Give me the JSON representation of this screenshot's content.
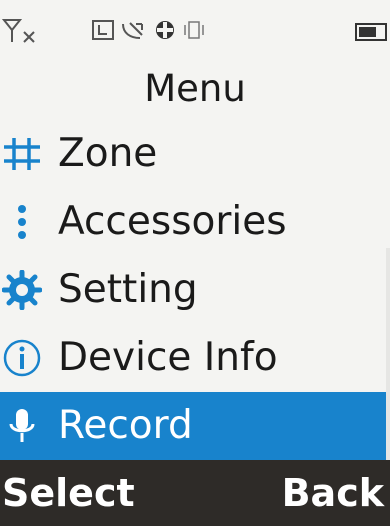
{
  "statusbar": {
    "icons": [
      "no-signal-icon",
      "sim-icon",
      "missed-call-icon",
      "data-icon",
      "vibrate-icon",
      "battery-icon"
    ]
  },
  "title": "Menu",
  "menu": {
    "items": [
      {
        "label": "Zone",
        "icon": "grid-icon"
      },
      {
        "label": "Accessories",
        "icon": "dots-icon"
      },
      {
        "label": "Setting",
        "icon": "gear-icon"
      },
      {
        "label": "Device Info",
        "icon": "info-icon"
      },
      {
        "label": "Record",
        "icon": "microphone-icon",
        "selected": true
      }
    ]
  },
  "softkeys": {
    "left": "Select",
    "right": "Back"
  },
  "colors": {
    "selection": "#1883cc",
    "softkey_bar": "#2e2b28",
    "background": "#f4f4f2"
  }
}
